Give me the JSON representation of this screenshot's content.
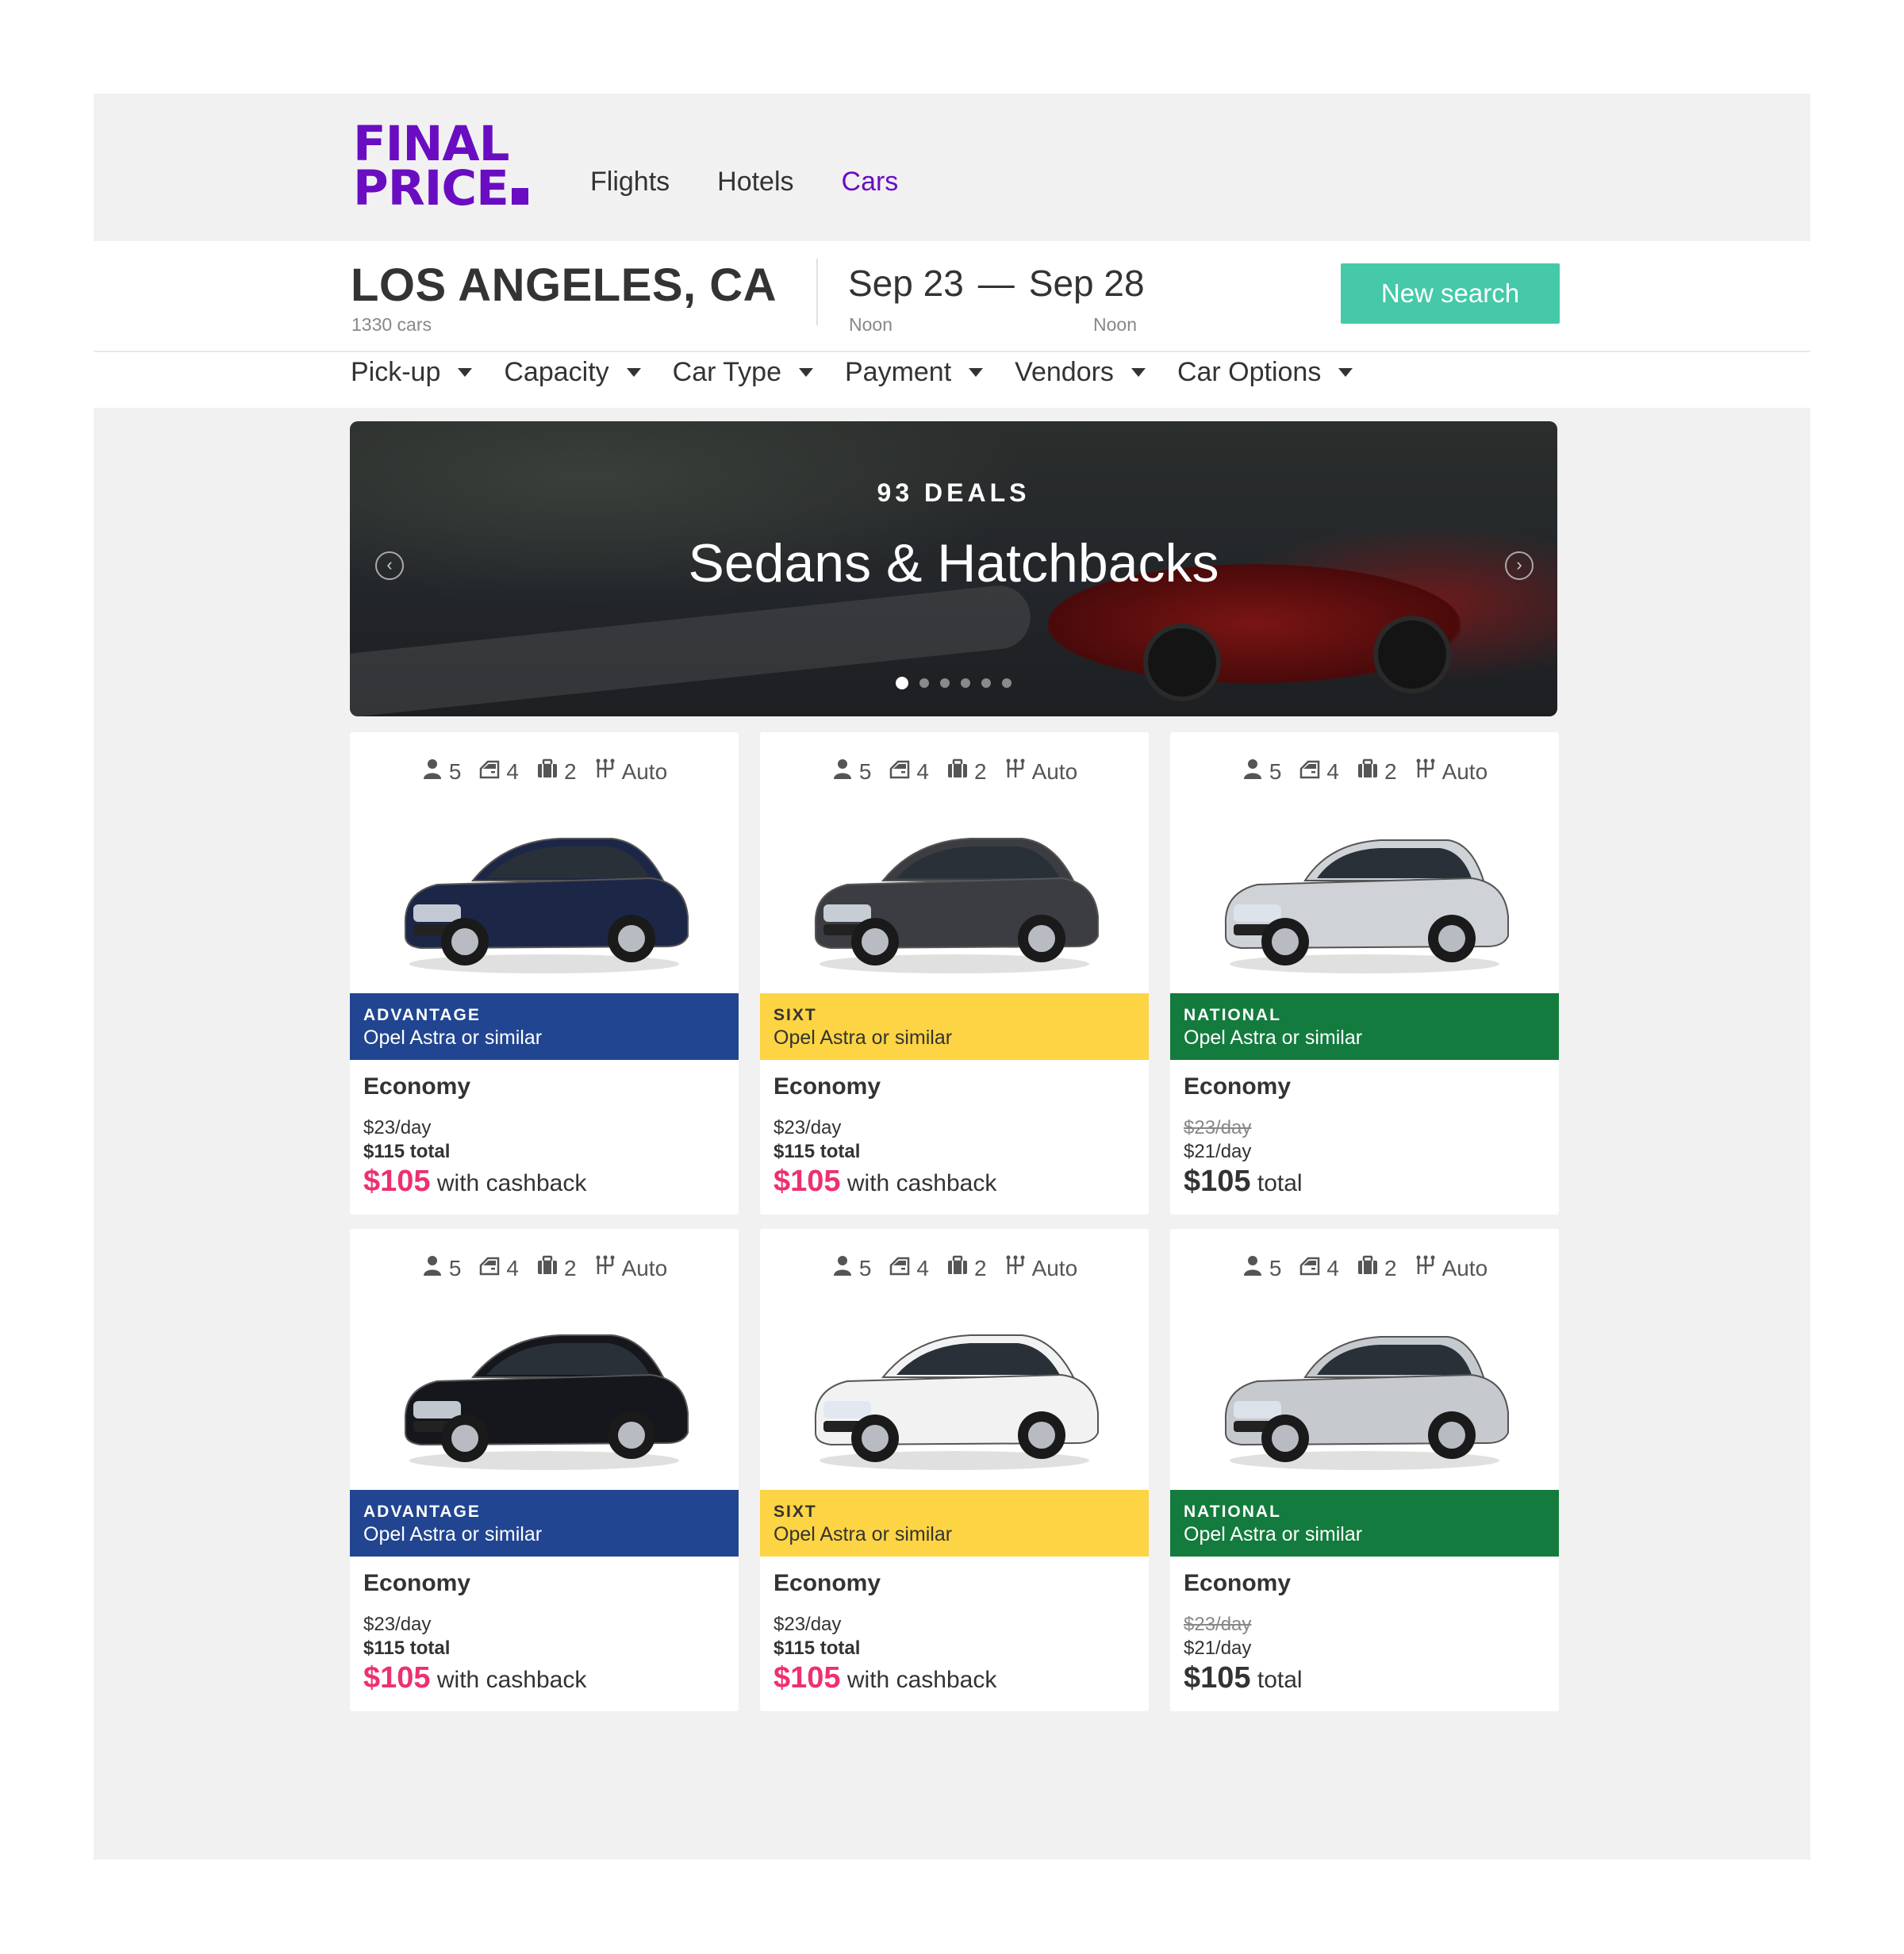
{
  "logo": {
    "line1": "FINAL",
    "line2": "PRICE"
  },
  "nav": [
    {
      "label": "Flights",
      "active": false
    },
    {
      "label": "Hotels",
      "active": false
    },
    {
      "label": "Cars",
      "active": true
    }
  ],
  "search": {
    "city": "LOS ANGELES, CA",
    "count": "1330 cars",
    "date_from": "Sep 23",
    "date_sep": "—",
    "date_to": "Sep 28",
    "time_from": "Noon",
    "time_to": "Noon",
    "button": "New search"
  },
  "filters": [
    "Pick-up",
    "Capacity",
    "Car Type",
    "Payment",
    "Vendors",
    "Car Options"
  ],
  "banner": {
    "deals": "93 DEALS",
    "title": "Sedans & Hatchbacks",
    "slides": 6,
    "active_slide": 0
  },
  "colors": {
    "brand": "#6a0dc2",
    "button": "#45c9a8",
    "cashback": "#ee2f72",
    "advantage": "#214590",
    "sixt": "#fdd444",
    "national": "#137b3d"
  },
  "cards": [
    {
      "specs": {
        "seats": "5",
        "doors": "4",
        "bags": "2",
        "trans": "Auto"
      },
      "vendor": "ADVANTAGE",
      "model": "Opel Astra or similar",
      "car_class": "Economy",
      "day": "$23/day",
      "total": "$115 total",
      "final_amount": "$105",
      "final_text": "with cashback",
      "color": "#214590",
      "text_color": "#ffffff",
      "car": "navy sedan",
      "car_color": "#1c2747"
    },
    {
      "specs": {
        "seats": "5",
        "doors": "4",
        "bags": "2",
        "trans": "Auto"
      },
      "vendor": "SIXT",
      "model": "Opel Astra or similar",
      "car_class": "Economy",
      "day": "$23/day",
      "total": "$115 total",
      "final_amount": "$105",
      "final_text": "with cashback",
      "color": "#fdd444",
      "text_color": "#333333",
      "car": "grey sedan",
      "car_color": "#3b3d42"
    },
    {
      "specs": {
        "seats": "5",
        "doors": "4",
        "bags": "2",
        "trans": "Auto"
      },
      "vendor": "NATIONAL",
      "model": "Opel Astra or similar",
      "car_class": "Economy",
      "day_old": "$23/day",
      "day": "$21/day",
      "final_amount": "$105",
      "final_text": "total",
      "color": "#137b3d",
      "text_color": "#ffffff",
      "car": "silver hatchback",
      "car_color": "#cfd2d6"
    },
    {
      "specs": {
        "seats": "5",
        "doors": "4",
        "bags": "2",
        "trans": "Auto"
      },
      "vendor": "ADVANTAGE",
      "model": "Opel Astra or similar",
      "car_class": "Economy",
      "day": "$23/day",
      "total": "$115 total",
      "final_amount": "$105",
      "final_text": "with cashback",
      "color": "#214590",
      "text_color": "#ffffff",
      "car": "black sedan",
      "car_color": "#15171c"
    },
    {
      "specs": {
        "seats": "5",
        "doors": "4",
        "bags": "2",
        "trans": "Auto"
      },
      "vendor": "SIXT",
      "model": "Opel Astra or similar",
      "car_class": "Economy",
      "day": "$23/day",
      "total": "$115 total",
      "final_amount": "$105",
      "final_text": "with cashback",
      "color": "#fdd444",
      "text_color": "#333333",
      "car": "white coupe",
      "car_color": "#f2f2f2"
    },
    {
      "specs": {
        "seats": "5",
        "doors": "4",
        "bags": "2",
        "trans": "Auto"
      },
      "vendor": "NATIONAL",
      "model": "Opel Astra or similar",
      "car_class": "Economy",
      "day_old": "$23/day",
      "day": "$21/day",
      "final_amount": "$105",
      "final_text": "total",
      "color": "#137b3d",
      "text_color": "#ffffff",
      "car": "silver hatchback",
      "car_color": "#c6c9cd"
    }
  ]
}
